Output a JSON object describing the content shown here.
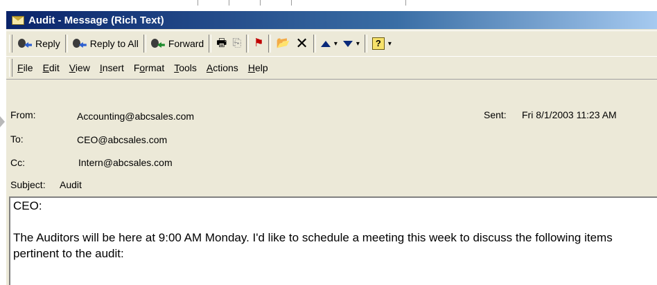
{
  "window": {
    "title": "Audit - Message (Rich Text)"
  },
  "toolbar": {
    "reply": "Reply",
    "reply_all": "Reply to All",
    "forward": "Forward"
  },
  "menubar": {
    "items": [
      {
        "pre": "",
        "u": "F",
        "post": "ile"
      },
      {
        "pre": "",
        "u": "E",
        "post": "dit"
      },
      {
        "pre": "",
        "u": "V",
        "post": "iew"
      },
      {
        "pre": "",
        "u": "I",
        "post": "nsert"
      },
      {
        "pre": "F",
        "u": "o",
        "post": "rmat"
      },
      {
        "pre": "",
        "u": "T",
        "post": "ools"
      },
      {
        "pre": "",
        "u": "A",
        "post": "ctions"
      },
      {
        "pre": "",
        "u": "H",
        "post": "elp"
      }
    ]
  },
  "header": {
    "from_label": "From:",
    "from_value": "Accounting@abcsales.com",
    "sent_label": "Sent:",
    "sent_value": "Fri 8/1/2003 11:23 AM",
    "to_label": "To:",
    "to_value": "CEO@abcsales.com",
    "cc_label": "Cc:",
    "cc_value": "Intern@abcsales.com",
    "subject_label": "Subject:",
    "subject_value": "Audit"
  },
  "body": {
    "greeting": "CEO:",
    "paragraph": "The Auditors will be here at 9:00 AM Monday.  I'd like to schedule a meeting this week to discuss the following items pertinent to the audit:"
  }
}
